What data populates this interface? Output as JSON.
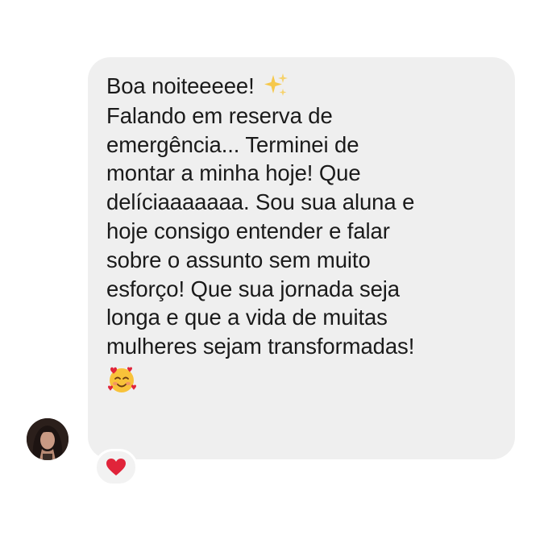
{
  "message": {
    "lines": [
      "Boa noiteeeee!",
      "Falando em reserva de",
      "emergência... Terminei de",
      "montar a minha hoje! Que",
      "delíciaaaaaaa. Sou sua aluna e",
      "hoje consigo entender e falar",
      "sobre o assunto sem muito",
      "esforço! Que sua jornada seja",
      "longa e que a vida de muitas",
      "mulheres sejam transformadas!"
    ],
    "inline_emoji": "sparkles-icon",
    "trailing_emoji": "smiling-face-with-hearts-icon"
  },
  "reaction": {
    "emoji": "red-heart-icon"
  },
  "colors": {
    "bubble_bg": "#efefef",
    "text": "#1a1a1a",
    "heart": "#e0243a",
    "sparkle": "#f6c84b"
  }
}
